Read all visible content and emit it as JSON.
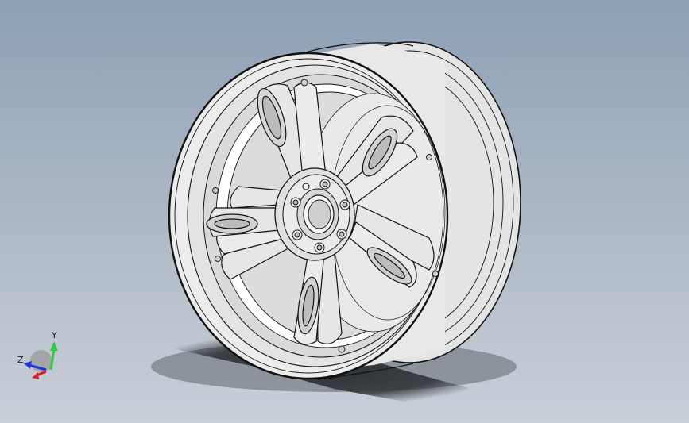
{
  "viewport": {
    "background_top": "#8ea0b5",
    "background_bottom": "#c9cfd7",
    "model": "wheel-rim",
    "model_fill": "#e6e6e6",
    "edge_color": "#111111",
    "shadow_color": "#2a2d32"
  },
  "triad": {
    "y_label": "Y",
    "z_label": "Z",
    "x_color": "#e02020",
    "y_color": "#2ecc40",
    "z_color": "#2233dd"
  }
}
